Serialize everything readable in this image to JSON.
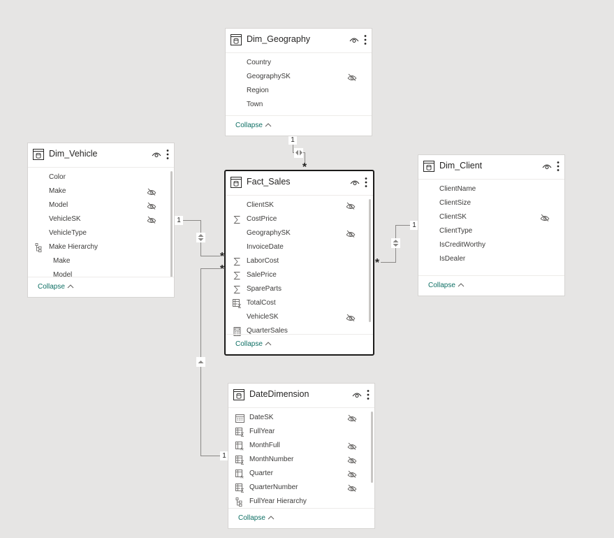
{
  "tables": {
    "geography": {
      "title": "Dim_Geography",
      "fields": [
        {
          "label": "Country",
          "icon": "none",
          "hidden": false
        },
        {
          "label": "GeographySK",
          "icon": "none",
          "hidden": true
        },
        {
          "label": "Region",
          "icon": "none",
          "hidden": false
        },
        {
          "label": "Town",
          "icon": "none",
          "hidden": false
        }
      ],
      "collapse_label": "Collapse"
    },
    "vehicle": {
      "title": "Dim_Vehicle",
      "fields": [
        {
          "label": "Color",
          "icon": "none",
          "hidden": false
        },
        {
          "label": "Make",
          "icon": "none",
          "hidden": true
        },
        {
          "label": "Model",
          "icon": "none",
          "hidden": true
        },
        {
          "label": "VehicleSK",
          "icon": "none",
          "hidden": true
        },
        {
          "label": "VehicleType",
          "icon": "none",
          "hidden": false
        },
        {
          "label": "Make Hierarchy",
          "icon": "hierarchy-icon",
          "hidden": false
        },
        {
          "label": "Make",
          "icon": "none",
          "hidden": false,
          "child": true
        },
        {
          "label": "Model",
          "icon": "none",
          "hidden": false,
          "child": true
        }
      ],
      "collapse_label": "Collapse"
    },
    "sales": {
      "title": "Fact_Sales",
      "fields": [
        {
          "label": "ClientSK",
          "icon": "none",
          "hidden": true
        },
        {
          "label": "CostPrice",
          "icon": "sigma-icon",
          "hidden": false
        },
        {
          "label": "GeographySK",
          "icon": "none",
          "hidden": true
        },
        {
          "label": "InvoiceDate",
          "icon": "none",
          "hidden": false
        },
        {
          "label": "LaborCost",
          "icon": "sigma-icon",
          "hidden": false
        },
        {
          "label": "SalePrice",
          "icon": "sigma-icon",
          "hidden": false
        },
        {
          "label": "SpareParts",
          "icon": "sigma-icon",
          "hidden": false
        },
        {
          "label": "TotalCost",
          "icon": "calculated-column-icon",
          "hidden": false
        },
        {
          "label": "VehicleSK",
          "icon": "none",
          "hidden": true
        },
        {
          "label": "QuarterSales",
          "icon": "measure-calculator-icon",
          "hidden": false
        }
      ],
      "collapse_label": "Collapse"
    },
    "client": {
      "title": "Dim_Client",
      "fields": [
        {
          "label": "ClientName",
          "icon": "none",
          "hidden": false
        },
        {
          "label": "ClientSize",
          "icon": "none",
          "hidden": false
        },
        {
          "label": "ClientSK",
          "icon": "none",
          "hidden": true
        },
        {
          "label": "ClientType",
          "icon": "none",
          "hidden": false
        },
        {
          "label": "IsCreditWorthy",
          "icon": "none",
          "hidden": false
        },
        {
          "label": "IsDealer",
          "icon": "none",
          "hidden": false
        }
      ],
      "collapse_label": "Collapse"
    },
    "date": {
      "title": "DateDimension",
      "fields": [
        {
          "label": "DateSK",
          "icon": "calendar-icon",
          "hidden": true
        },
        {
          "label": "FullYear",
          "icon": "calculated-column-icon",
          "hidden": false
        },
        {
          "label": "MonthFull",
          "icon": "calculated-text-column-icon",
          "hidden": true
        },
        {
          "label": "MonthNumber",
          "icon": "calculated-column-icon",
          "hidden": true
        },
        {
          "label": "Quarter",
          "icon": "calculated-text-column-icon",
          "hidden": true
        },
        {
          "label": "QuarterNumber",
          "icon": "calculated-column-icon",
          "hidden": true
        },
        {
          "label": "FullYear Hierarchy",
          "icon": "hierarchy-icon",
          "hidden": false
        }
      ],
      "collapse_label": "Collapse"
    }
  },
  "relationships": [
    {
      "from": "Dim_Geography",
      "to": "Fact_Sales",
      "one_label": "1",
      "many_label": "*",
      "direction": "both"
    },
    {
      "from": "Dim_Vehicle",
      "to": "Fact_Sales",
      "one_label": "1",
      "many_label": "*",
      "direction": "both"
    },
    {
      "from": "Dim_Client",
      "to": "Fact_Sales",
      "one_label": "1",
      "many_label": "*",
      "direction": "both"
    },
    {
      "from": "DateDimension",
      "to": "Fact_Sales",
      "one_label": "1",
      "many_label": "*",
      "direction": "single"
    }
  ],
  "colors": {
    "canvas": "#e6e5e4",
    "link": "#0e6f64",
    "relationship_line": "#8a8886",
    "selected_border": "#1b1a19"
  }
}
